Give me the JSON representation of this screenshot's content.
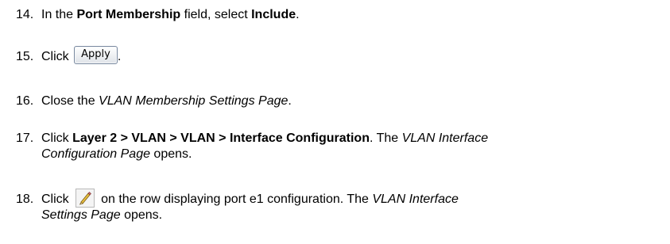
{
  "steps": [
    {
      "number": "14.",
      "pre": "In the ",
      "b1": "Port Membership",
      "mid": " field, select ",
      "b2": "Include",
      "post": "."
    },
    {
      "number": "15.",
      "pre": "Click ",
      "button": "Apply",
      "post": "."
    },
    {
      "number": "16.",
      "pre": "Close the ",
      "i1": "VLAN Membership Settings Page",
      "post": "."
    },
    {
      "number": "17.",
      "pre": "Click ",
      "b1": "Layer 2 > VLAN > VLAN > Interface Configuration",
      "mid": ". The ",
      "i1a": "VLAN Interface",
      "i1b": "Configuration Page",
      "post": " opens."
    },
    {
      "number": "18.",
      "pre": "Click ",
      "icon": "pencil-edit-icon",
      "mid": "on the row displaying port e1 configuration. The ",
      "i1a": "VLAN Interface",
      "i1b": "Settings Page",
      "post": " opens."
    }
  ]
}
